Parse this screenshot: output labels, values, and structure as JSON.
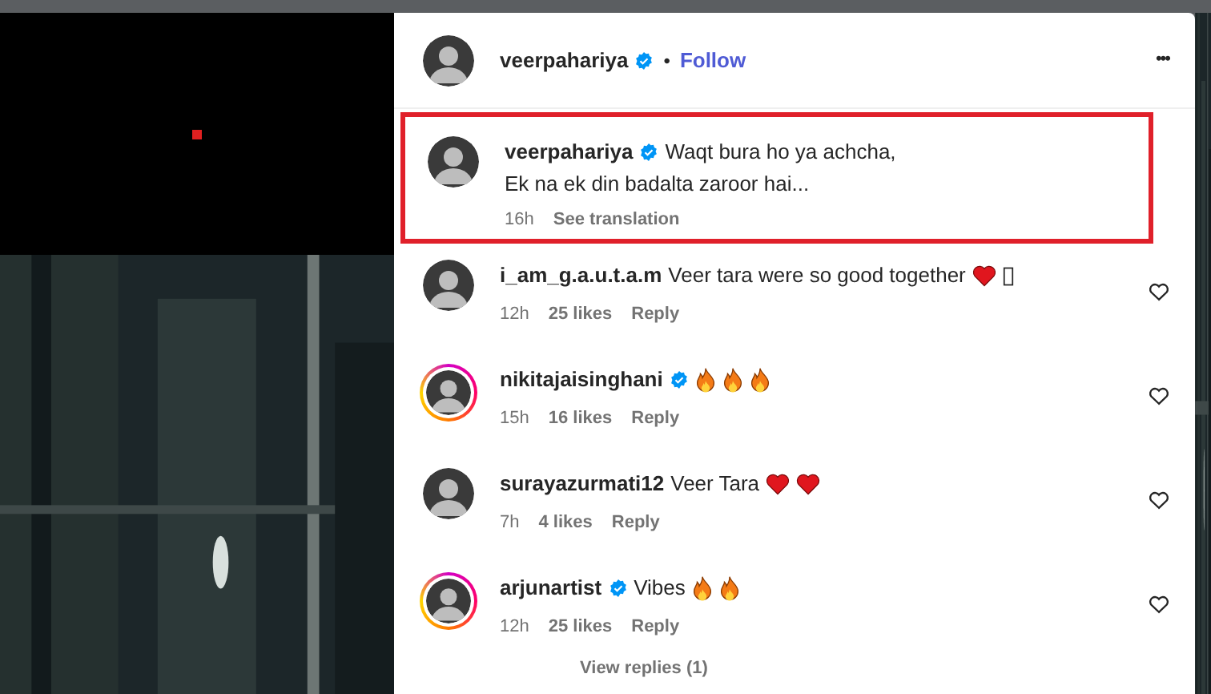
{
  "post_header": {
    "username": "veerpahariya",
    "verified": true,
    "separator": "•",
    "follow": "Follow",
    "more": "•••"
  },
  "caption": {
    "username": "veerpahariya",
    "verified": true,
    "lines": [
      "Waqt bura ho ya achcha,",
      "Ek na ek din badalta zaroor hai..."
    ],
    "time": "16h",
    "translate": "See translation",
    "highlighted": true
  },
  "comments": [
    {
      "username": "i_am_g.a.u.t.a.m",
      "verified": false,
      "story_ring": false,
      "text": "Veer tara were so good together",
      "emojis": [
        {
          "kind": "heart"
        },
        {
          "kind": "missing"
        }
      ],
      "time": "12h",
      "likes": "25 likes",
      "reply": "Reply"
    },
    {
      "username": "nikitajaisinghani",
      "verified": true,
      "story_ring": true,
      "emojis": [
        {
          "kind": "fire"
        },
        {
          "kind": "fire"
        },
        {
          "kind": "fire"
        }
      ],
      "time": "15h",
      "likes": "16 likes",
      "reply": "Reply"
    },
    {
      "username": "surayazurmati12",
      "verified": false,
      "story_ring": false,
      "text": "Veer Tara",
      "emojis": [
        {
          "kind": "heart"
        },
        {
          "kind": "heart"
        }
      ],
      "time": "7h",
      "likes": "4 likes",
      "reply": "Reply"
    },
    {
      "username": "arjunartist",
      "verified": true,
      "story_ring": true,
      "text": "Vibes",
      "emojis": [
        {
          "kind": "fire"
        },
        {
          "kind": "fire"
        }
      ],
      "time": "12h",
      "likes": "25 likes",
      "reply": "Reply",
      "view_replies": "View replies (1)"
    }
  ]
}
